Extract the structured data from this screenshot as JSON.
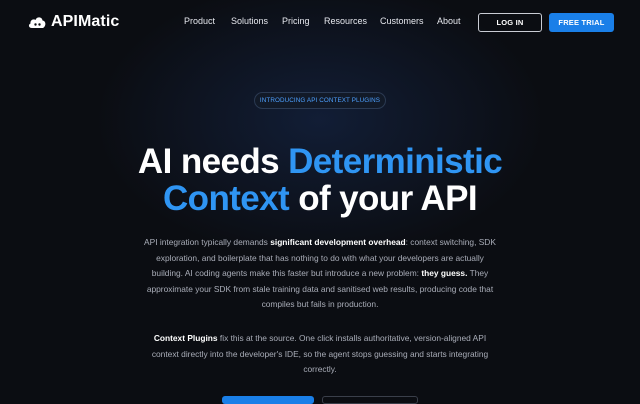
{
  "brand": {
    "name": "APIMatic"
  },
  "nav": {
    "items": [
      "Product",
      "Solutions",
      "Pricing",
      "Resources",
      "Customers",
      "About"
    ],
    "login_label": "LOG IN",
    "trial_label": "FREE TRIAL"
  },
  "hero": {
    "badge": "INTRODUCING API CONTEXT PLUGINS",
    "headline": {
      "line1_a": "AI needs ",
      "line1_b": "Deterministic",
      "line2_a": "Context",
      "line2_b": " of your API"
    },
    "p1": {
      "a": "API integration typically demands ",
      "b": "significant development overhead",
      "c": ": context switching, SDK exploration, and boilerplate that has nothing to do with what your developers are actually building. AI coding agents make this faster but introduce a new problem: ",
      "d": "they guess.",
      "e": " They approximate your SDK from stale training data and sanitised web results, producing code that compiles but fails in production."
    },
    "p2": {
      "a": "Context Plugins",
      "b": " fix this at the source. One click installs authoritative, version-aligned API context directly into the developer's IDE, so the agent stops guessing and starts integrating correctly."
    }
  },
  "colors": {
    "background": "#0b0d12",
    "accent": "#1a7fe8",
    "highlight": "#2f95f3",
    "badge_text": "#4da0ff"
  }
}
